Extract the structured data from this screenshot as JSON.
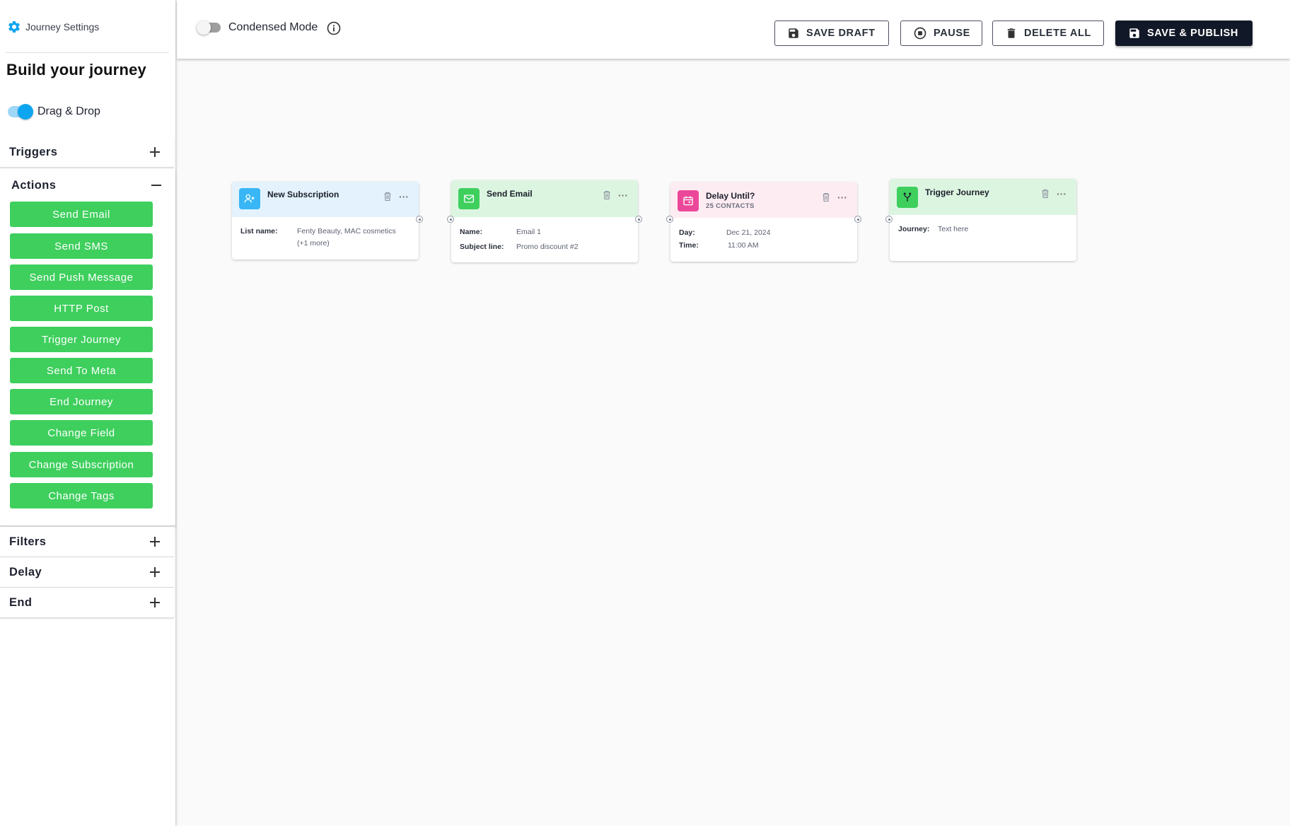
{
  "sidebar": {
    "settings_label": "Journey Settings",
    "build_title": "Build your journey",
    "drag_drop_label": "Drag & Drop",
    "drag_drop_on": true,
    "sections": {
      "triggers": "Triggers",
      "actions": "Actions",
      "filters": "Filters",
      "delay": "Delay",
      "end": "End"
    },
    "actions": [
      "Send Email",
      "Send SMS",
      "Send Push Message",
      "HTTP Post",
      "Trigger Journey",
      "Send To Meta",
      "End Journey",
      "Change Field",
      "Change Subscription",
      "Change Tags"
    ]
  },
  "topbar": {
    "condensed_label": "Condensed Mode",
    "condensed_on": false,
    "buttons": {
      "save_draft": "SAVE DRAFT",
      "pause": "PAUSE",
      "delete_all": "DELETE ALL",
      "save_publish": "SAVE & PUBLISH"
    }
  },
  "nodes": [
    {
      "title": "New Subscription",
      "fields": [
        {
          "label": "List name:",
          "value": "Fenty Beauty, MAC cosmetics"
        },
        {
          "label": "",
          "value": "(+1 more)"
        }
      ]
    },
    {
      "title": "Send Email",
      "fields": [
        {
          "label": "Name:",
          "value": "Email 1"
        },
        {
          "label": "Subject line:",
          "value": "Promo discount #2"
        }
      ]
    },
    {
      "title": "Delay Until?",
      "subtitle": "25 CONTACTS",
      "fields": [
        {
          "label": "Day:",
          "value": "Dec 21, 2024"
        },
        {
          "label": "Time:",
          "value": "11:00 AM"
        }
      ]
    },
    {
      "title": "Trigger Journey",
      "fields": [
        {
          "label": "Journey:",
          "value": "Text here"
        }
      ]
    }
  ],
  "colors": {
    "accent_blue": "#0ea5f0",
    "action_green": "#3ecf5d",
    "primary_dark": "#111827",
    "subscription_header": "#e3f2fd",
    "email_header": "#dcf5e1",
    "delay_header": "#fdecf2",
    "trigger_header": "#dcf5e1"
  }
}
